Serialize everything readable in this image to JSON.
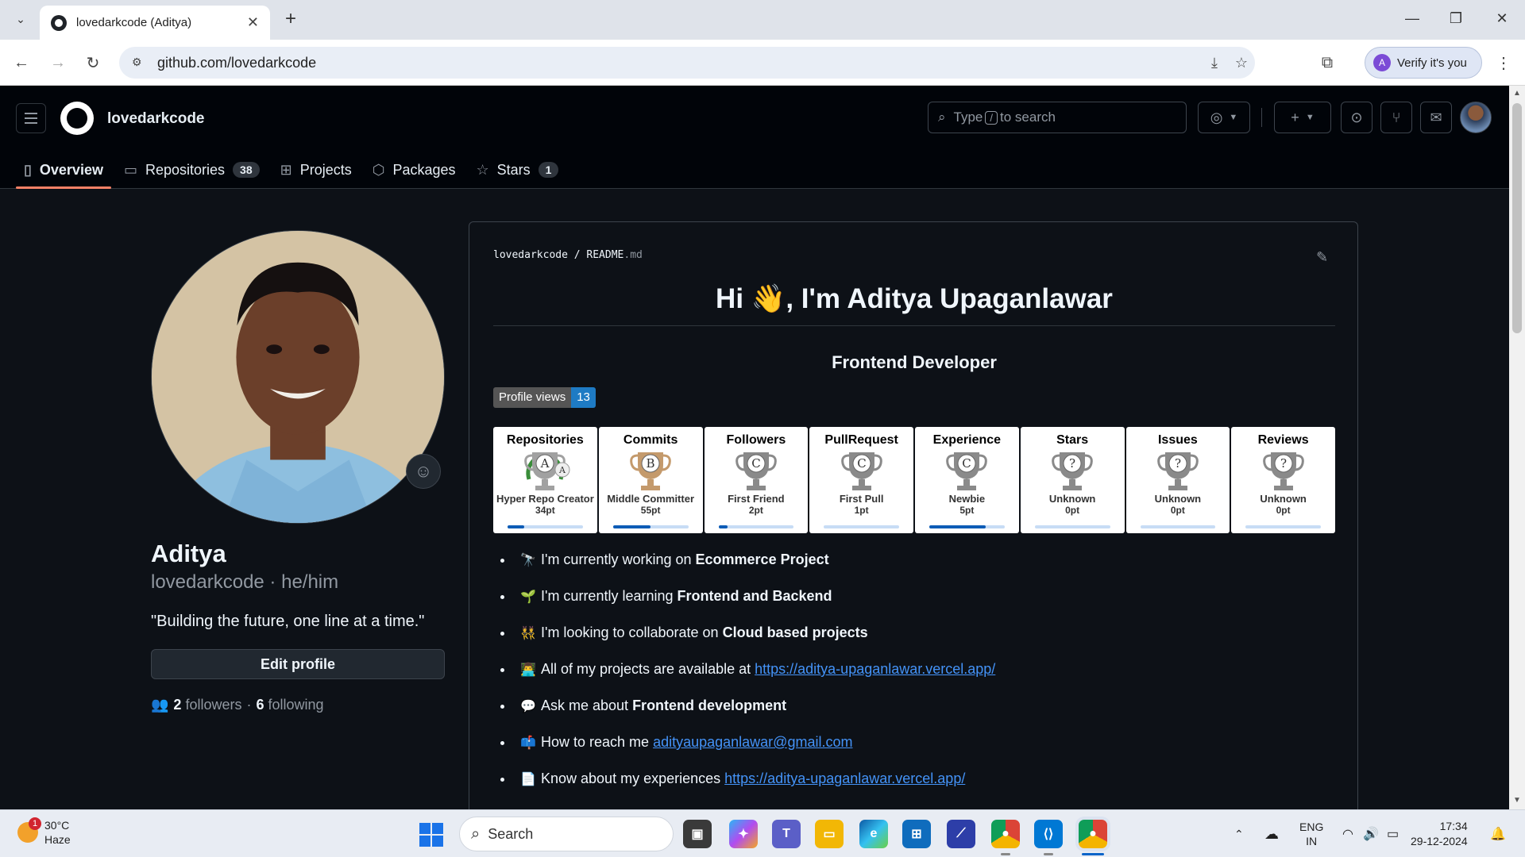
{
  "browser": {
    "tab_title": "lovedarkcode (Aditya)",
    "url": "github.com/lovedarkcode",
    "verify_label": "Verify it's you",
    "profile_initial": "A"
  },
  "header": {
    "username": "lovedarkcode",
    "search_prefix": "Type",
    "search_key": "/",
    "search_suffix": "to search",
    "tabs": [
      {
        "label": "Overview",
        "icon": "book-icon"
      },
      {
        "label": "Repositories",
        "icon": "repo-icon",
        "count": "38"
      },
      {
        "label": "Projects",
        "icon": "table-icon"
      },
      {
        "label": "Packages",
        "icon": "package-icon"
      },
      {
        "label": "Stars",
        "icon": "star-icon",
        "count": "1"
      }
    ]
  },
  "profile": {
    "name": "Aditya",
    "login": "lovedarkcode",
    "pronouns": "he/him",
    "bio": "\"Building the future, one line at a time.\"",
    "edit_label": "Edit profile",
    "followers_count": "2",
    "followers_label": "followers",
    "following_count": "6",
    "following_label": "following"
  },
  "readme": {
    "owner": "lovedarkcode",
    "file": "README",
    "ext": ".md",
    "heading": "Hi 👋, I'm Aditya Upaganlawar",
    "subheading": "Frontend Developer",
    "views_label": "Profile views",
    "views_count": "13",
    "trophies": [
      {
        "title": "Repositories",
        "letter": "A",
        "rank": "Hyper Repo Creator",
        "points": "34pt",
        "progress": 0.22,
        "color": "#a1a1a1",
        "laurel": true,
        "secondary": "A"
      },
      {
        "title": "Commits",
        "letter": "B",
        "rank": "Middle Committer",
        "points": "55pt",
        "progress": 0.5,
        "color": "#c49a6c",
        "laurel": false
      },
      {
        "title": "Followers",
        "letter": "C",
        "rank": "First Friend",
        "points": "2pt",
        "progress": 0.12,
        "color": "#8a8a8a",
        "laurel": false
      },
      {
        "title": "PullRequest",
        "letter": "C",
        "rank": "First Pull",
        "points": "1pt",
        "progress": 0.0,
        "color": "#8a8a8a",
        "laurel": false
      },
      {
        "title": "Experience",
        "letter": "C",
        "rank": "Newbie",
        "points": "5pt",
        "progress": 0.75,
        "color": "#8a8a8a",
        "laurel": false
      },
      {
        "title": "Stars",
        "letter": "?",
        "rank": "Unknown",
        "points": "0pt",
        "progress": 0.0,
        "color": "#8a8a8a",
        "laurel": false
      },
      {
        "title": "Issues",
        "letter": "?",
        "rank": "Unknown",
        "points": "0pt",
        "progress": 0.0,
        "color": "#8a8a8a",
        "laurel": false
      },
      {
        "title": "Reviews",
        "letter": "?",
        "rank": "Unknown",
        "points": "0pt",
        "progress": 0.0,
        "color": "#8a8a8a",
        "laurel": false
      }
    ],
    "items": [
      {
        "emoji": "🔭",
        "text": "I'm currently working on ",
        "bold": "Ecommerce Project"
      },
      {
        "emoji": "🌱",
        "text": "I'm currently learning ",
        "bold": "Frontend and Backend"
      },
      {
        "emoji": "👯",
        "text": "I'm looking to collaborate on ",
        "bold": "Cloud based projects"
      },
      {
        "emoji": "👨‍💻",
        "text": "All of my projects are available at ",
        "link": "https://aditya-upaganlawar.vercel.app/"
      },
      {
        "emoji": "💬",
        "text": "Ask me about ",
        "bold": "Frontend development"
      },
      {
        "emoji": "📫",
        "text": "How to reach me ",
        "link": "adityaupaganlawar@gmail.com"
      },
      {
        "emoji": "📄",
        "text": "Know about my experiences ",
        "link": "https://aditya-upaganlawar.vercel.app/"
      }
    ]
  },
  "taskbar": {
    "temperature": "30°C",
    "weather": "Haze",
    "weather_badge": "1",
    "search_label": "Search",
    "lang_top": "ENG",
    "lang_bottom": "IN",
    "time": "17:34",
    "date": "29-12-2024"
  }
}
